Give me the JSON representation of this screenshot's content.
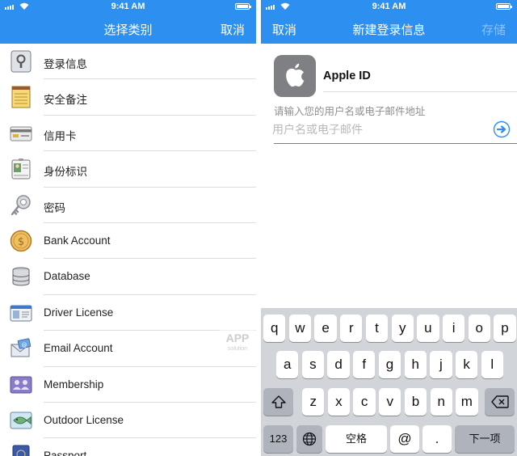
{
  "status_bar": {
    "time": "9:41 AM"
  },
  "left_screen": {
    "title": "选择类别",
    "cancel_label": "取消",
    "categories": [
      {
        "label": "登录信息",
        "icon": "login-icon"
      },
      {
        "label": "安全备注",
        "icon": "secure-note-icon"
      },
      {
        "label": "信用卡",
        "icon": "credit-card-icon"
      },
      {
        "label": "身份标识",
        "icon": "identity-icon"
      },
      {
        "label": "密码",
        "icon": "password-key-icon"
      },
      {
        "label": "Bank Account",
        "icon": "bank-coin-icon"
      },
      {
        "label": "Database",
        "icon": "database-icon"
      },
      {
        "label": "Driver License",
        "icon": "driver-license-icon"
      },
      {
        "label": "Email Account",
        "icon": "email-icon"
      },
      {
        "label": "Membership",
        "icon": "membership-icon"
      },
      {
        "label": "Outdoor License",
        "icon": "outdoor-fish-icon"
      },
      {
        "label": "Passport",
        "icon": "passport-icon"
      }
    ]
  },
  "right_screen": {
    "title": "新建登录信息",
    "cancel_label": "取消",
    "save_label": "存储",
    "item_title": "Apple ID",
    "field_hint": "请输入您的用户名或电子邮件地址",
    "field_placeholder": "用户名或电子邮件",
    "field_value": ""
  },
  "keyboard": {
    "row1": [
      "q",
      "w",
      "e",
      "r",
      "t",
      "y",
      "u",
      "i",
      "o",
      "p"
    ],
    "row2": [
      "a",
      "s",
      "d",
      "f",
      "g",
      "h",
      "j",
      "k",
      "l"
    ],
    "row3": [
      "z",
      "x",
      "c",
      "v",
      "b",
      "n",
      "m"
    ],
    "numbers_label": "123",
    "space_label": "空格",
    "at_label": "@",
    "dot_label": ".",
    "next_label": "下一项"
  },
  "watermark": {
    "text": "APP",
    "subtext": "solution"
  },
  "colors": {
    "accent": "#2d8ff0",
    "keyboard_bg": "#d1d4d9"
  }
}
